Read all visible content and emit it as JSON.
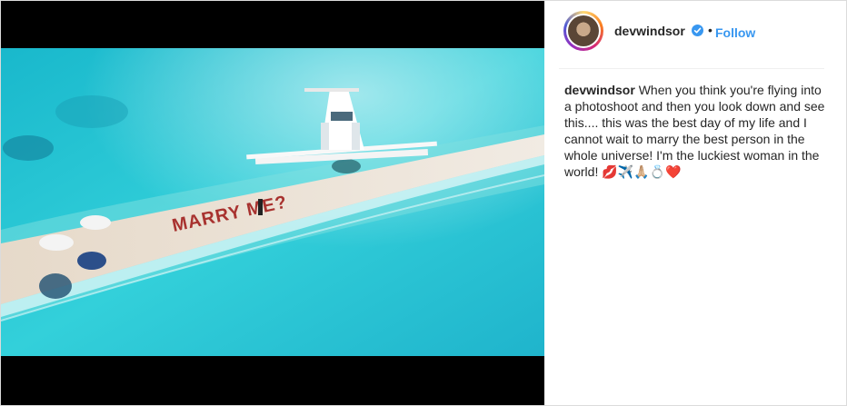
{
  "post": {
    "username": "devwindsor",
    "separator": "•",
    "follow_label": "Follow",
    "caption": "When you think you're flying into a photoshoot and then you look down and see this.... this was the best day of my life and I cannot wait to marry the best person in the whole universe! I'm the luckiest woman in the world! 💋✈️🙏🏼💍❤️",
    "image_text": "MARRY ME?"
  },
  "icons": {
    "verified": "verified-badge-icon",
    "avatar": "profile-avatar"
  },
  "colors": {
    "link_blue": "#3897f0",
    "text": "#262626",
    "border": "#dbdbdb",
    "sea": "#2cc6d4",
    "sand": "#e8ded0",
    "letters": "#a8322f"
  }
}
